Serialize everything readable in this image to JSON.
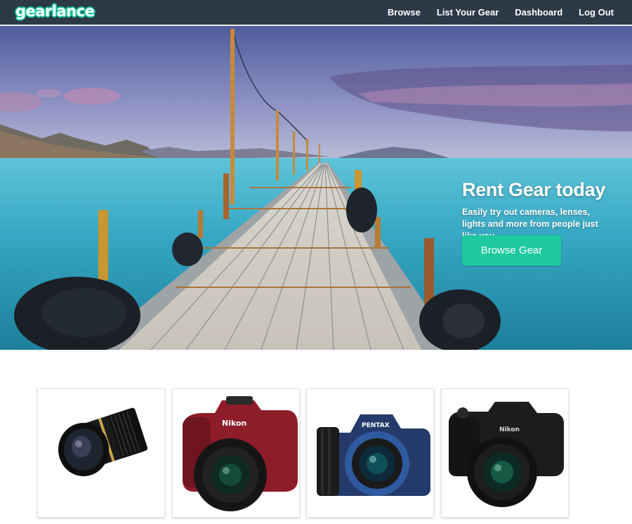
{
  "navbar": {
    "logo_text": "gearlance",
    "links": [
      "Browse",
      "List Your Gear",
      "Dashboard",
      "Log Out"
    ]
  },
  "hero": {
    "title": "Rent Gear today",
    "subtitle": "Easily try out cameras, lenses, lights and more from people just like you.",
    "button_label": "Browse Gear",
    "image": "pier-over-turquoise-sea-photo"
  },
  "products": [
    {
      "image": "zoom-lens-photo",
      "brand_text": ""
    },
    {
      "image": "red-nikon-dslr-photo",
      "brand_text": "Nikon"
    },
    {
      "image": "blue-pentax-dslr-photo",
      "brand_text": "PENTAX"
    },
    {
      "image": "black-nikon-bridge-camera-photo",
      "brand_text": "Nikon"
    }
  ],
  "colors": {
    "navbar": "#2c3a48",
    "accent": "#1ec9a0",
    "text_light": "#ffffff"
  }
}
